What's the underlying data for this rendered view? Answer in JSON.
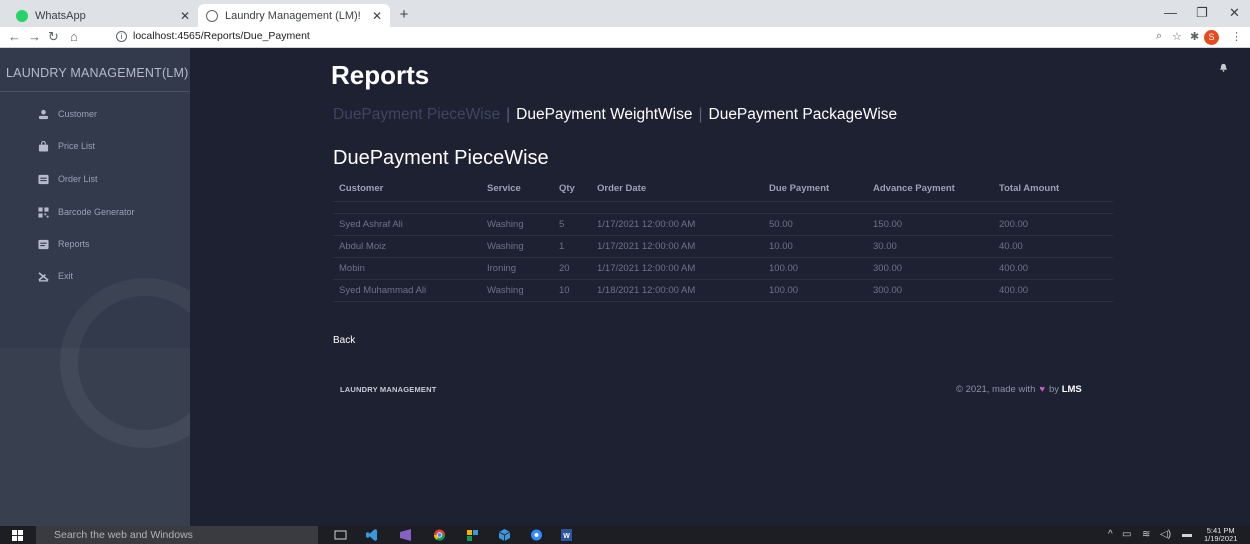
{
  "browser": {
    "tabs": [
      {
        "title": "WhatsApp",
        "favicon_color": "#25d366"
      },
      {
        "title": "Laundry Management (LM)!",
        "favicon_color": "#5f6368"
      }
    ],
    "url": "localhost:4565/Reports/Due_Payment",
    "profile_initial": "S"
  },
  "sidebar": {
    "brand": "LAUNDRY MANAGEMENT(LM)",
    "items": [
      {
        "label": "Customer",
        "icon": "person-icon"
      },
      {
        "label": "Price List",
        "icon": "bag-icon"
      },
      {
        "label": "Order List",
        "icon": "list-icon"
      },
      {
        "label": "Barcode Generator",
        "icon": "barcode-icon"
      },
      {
        "label": "Reports",
        "icon": "report-icon"
      },
      {
        "label": "Exit",
        "icon": "exit-icon"
      }
    ]
  },
  "page": {
    "title": "Reports",
    "subnav": [
      "DuePayment PieceWise",
      "DuePayment WeightWise",
      "DuePayment PackageWise"
    ],
    "section_title": "DuePayment PieceWise",
    "back_label": "Back"
  },
  "table": {
    "headers": [
      "Customer",
      "Service",
      "Qty",
      "Order Date",
      "Due Payment",
      "Advance Payment",
      "Total Amount"
    ],
    "rows": [
      [
        "Syed Ashraf Ali",
        "Washing",
        "5",
        "1/17/2021 12:00:00 AM",
        "50.00",
        "150.00",
        "200.00"
      ],
      [
        "Abdul Moiz",
        "Washing",
        "1",
        "1/17/2021 12:00:00 AM",
        "10.00",
        "30.00",
        "40.00"
      ],
      [
        "Mobin",
        "Ironing",
        "20",
        "1/17/2021 12:00:00 AM",
        "100.00",
        "300.00",
        "400.00"
      ],
      [
        "Syed Muhammad Ali",
        "Washing",
        "10",
        "1/18/2021 12:00:00 AM",
        "100.00",
        "300.00",
        "400.00"
      ]
    ]
  },
  "footer": {
    "left": "LAUNDRY MANAGEMENT",
    "right_prefix": "© 2021, made with",
    "right_by": "by",
    "right_brand": "LMS"
  },
  "taskbar": {
    "search_placeholder": "Search the web and Windows",
    "time": "5:41 PM",
    "date": "1/19/2021"
  },
  "colors": {
    "background": "#1e2131",
    "sidebar": "#323a4b",
    "heart": "#c65cc6"
  }
}
